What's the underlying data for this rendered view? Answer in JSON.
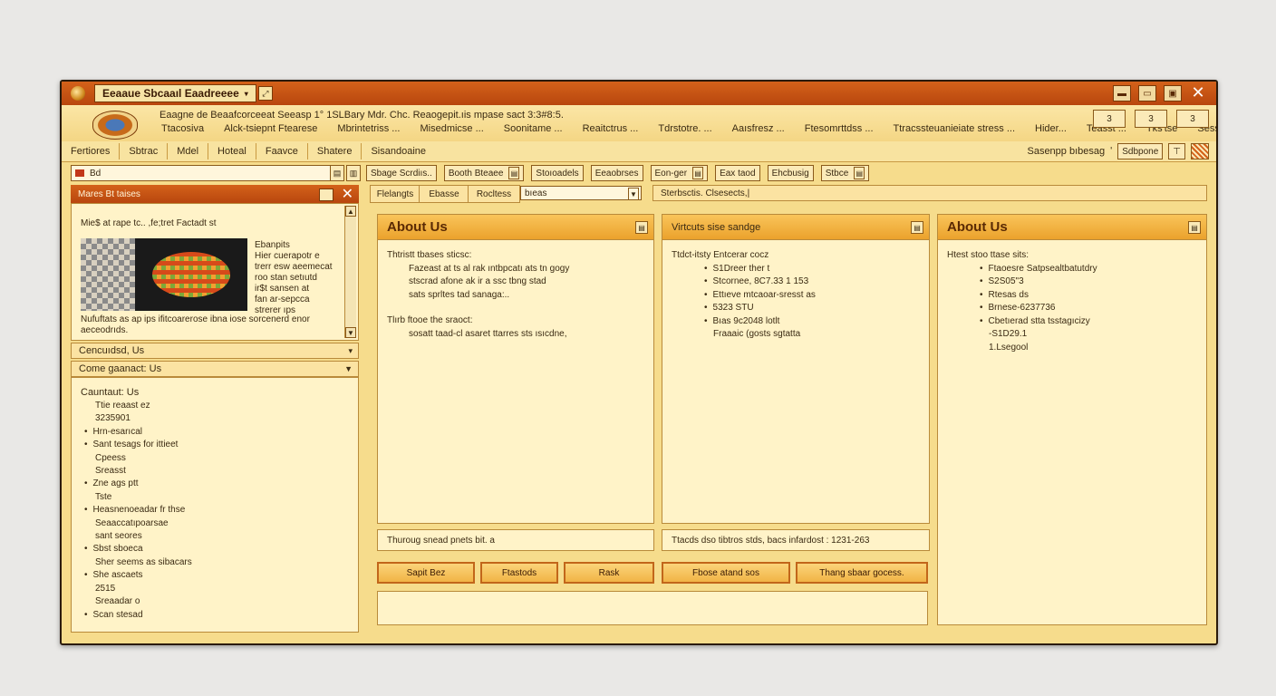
{
  "window": {
    "title": "Eeaaue Sbcaaıl Eaadreeee",
    "controls": [
      "▬",
      "▭",
      "▣",
      "✕"
    ]
  },
  "menu": {
    "line1": "Eaagne de Beaafcorceeat Seeasp 1° 1SLBary Mdr. Chc. Reaogepit.ıis mpase sact 3:3#8:5.",
    "items": [
      "Ttacosiva",
      "Alck-tsiepnt Ftearese",
      "Mbrintetriss ...",
      "Misedmicse ...",
      "Soonitame ...",
      "Reaitctrus ...",
      "Tdrstotre. ...",
      "Aaısfresz ...",
      "Ftesomrttdss ...",
      "Ttracssteuanieiate stress ...",
      "Hider...",
      "Teasst ...",
      "Tks'tse",
      "Sesst"
    ],
    "right_buttons": [
      "3",
      "3",
      "3"
    ]
  },
  "toolbar": {
    "items": [
      "Fertiores",
      "Sbtrac",
      "Mdel",
      "Hoteal",
      "Faavce",
      "Shatere",
      "Sisandoaine"
    ],
    "right_label": "Sasenpp bıbesag",
    "right_box": "Sdbpone"
  },
  "addressbar": {
    "value": "Bd",
    "tools": [
      {
        "label": "Sbage Scrdiıs..",
        "dd": false
      },
      {
        "label": "Booth Bteaee",
        "dd": true
      },
      {
        "label": "Stoıoadels",
        "dd": false
      },
      {
        "label": "Eeaobrses",
        "dd": false
      },
      {
        "label": "Eon-ger",
        "dd": true
      },
      {
        "label": "Eax taod",
        "dd": false
      },
      {
        "label": "Ehcbusig",
        "dd": false
      },
      {
        "label": "Stbce",
        "dd": true
      }
    ]
  },
  "left": {
    "header": "Mares Bt taises",
    "subtitle": "Mie$ at rape tc.. ,fe;tret Factadt st",
    "side_text": [
      "Ebanpits",
      "Hier cuerapotr e",
      "trerr esw aeemecat",
      "roo stan setıutd",
      "ir$t sansen at",
      "fan ar-sepcca",
      "strerer ıps"
    ],
    "caption": "Nufuftats as ap ips ifitcoarerose ibna iose sorcenerd enor aeceodrıds.",
    "acc1": "Cencuıdsd, Us",
    "acc2": "Come gaanact: Us",
    "contact_heading": "Cauntaut: Us",
    "contact_items": [
      {
        "text": "Ttie reaast ez",
        "b": false
      },
      {
        "text": "3235901",
        "b": false
      },
      {
        "text": "Hrn-esarıcal",
        "b": true
      },
      {
        "text": "Sant tesags for ittieet",
        "b": true
      },
      {
        "text": "Cpeess",
        "b": false
      },
      {
        "text": "Sreasst",
        "b": false
      },
      {
        "text": "Zne ags ptt",
        "b": true
      },
      {
        "text": "Tste",
        "b": false
      },
      {
        "text": "Heasnenoeadar fr thse",
        "b": true
      },
      {
        "text": "Seaaccatıpoarsae",
        "b": false
      },
      {
        "text": "sant seores",
        "b": false
      },
      {
        "text": "Sbst sboeca",
        "b": true
      },
      {
        "text": "Sher seems as sibacars",
        "b": false
      },
      {
        "text": "She ascaets",
        "b": true
      },
      {
        "text": "2515",
        "b": false
      },
      {
        "text": "Sreaadar o",
        "b": false
      },
      {
        "text": "Scan stesad",
        "b": true
      }
    ]
  },
  "tabs": {
    "items": [
      "Flelangts",
      "Ebasse",
      "Rocltess"
    ],
    "select_value": "bıeas",
    "status": "Sterbsctis. Clsesects,|"
  },
  "cards": [
    {
      "title": "About Us",
      "lead": "Thtristt tbases sticsc:",
      "lines": [
        "Fazeast at ts al rak ıntbpcatı ats tn gogy",
        "stscrad afone ak ir a ssc tbng stad",
        "sats sprltes tad sanaga:.."
      ],
      "lead2": "Tlırb ftooe the sraoct:",
      "lines2": [
        "sosatt taad-cl asaret ttarres sts ısıcdne,"
      ]
    },
    {
      "title": "Virtcuts sise sandge",
      "lead": "Ttdct-itsty Entcerar cocz",
      "items": [
        {
          "text": "S1Dreer ther t",
          "b": true
        },
        {
          "text": "Stcornee, 8C7.33 1 153",
          "b": true
        },
        {
          "text": "Ettıeve mtcaoar-sresst as",
          "b": true
        },
        {
          "text": "5323 STU",
          "b": true
        },
        {
          "text": "Bıas 9c2048 lotlt",
          "b": true
        },
        {
          "text": "Fraaaic (gosts sgtatta",
          "b": false
        }
      ]
    },
    {
      "title": "About Us",
      "lead": "Htest stoo ttase sits:",
      "items": [
        {
          "text": "Ftaoesre Satpsealtbatutdry",
          "b": true
        },
        {
          "text": "S2S05\"3",
          "b": true
        },
        {
          "text": "Rtesas ds",
          "b": true
        },
        {
          "text": "Brnese-6237736",
          "b": true
        },
        {
          "text": "Cbetıerad stta tsstagıcizy",
          "b": true
        },
        {
          "text": "-S1D29.1",
          "b": false
        },
        {
          "text": "1.Lsegool",
          "b": false
        }
      ]
    }
  ],
  "strips": [
    "Thuroug snead pnets bit. a",
    "Ttacds dso tibtros stds, bacs infardost  :  1231-263"
  ],
  "action_buttons": [
    "Sapit Bez",
    "Ftastods",
    "Rask",
    "Fbose atand sos",
    "Thang sbaar gocess."
  ]
}
